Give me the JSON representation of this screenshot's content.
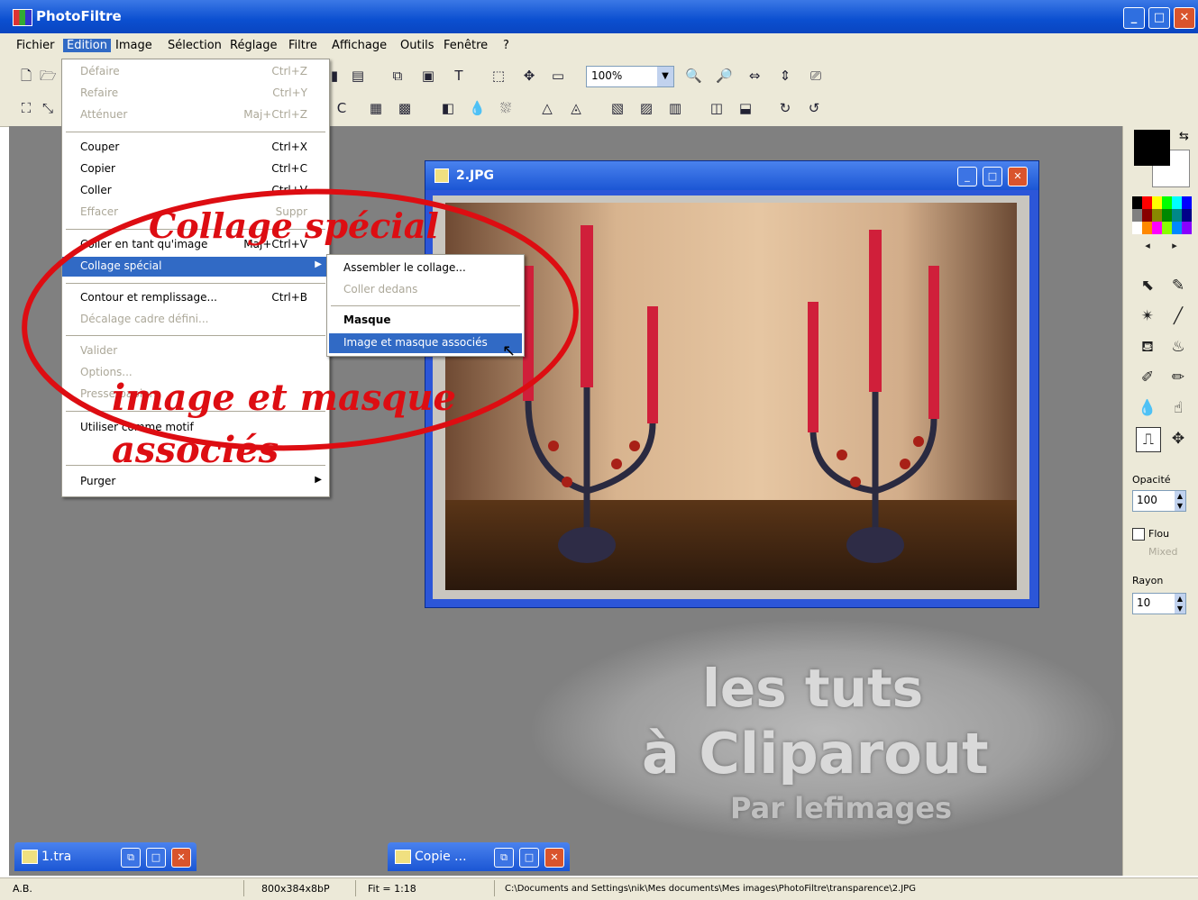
{
  "window": {
    "title": "PhotoFiltre"
  },
  "menubar": [
    "Fichier",
    "Edition",
    "Image",
    "Sélection",
    "Réglage",
    "Filtre",
    "Affichage",
    "Outils",
    "Fenêtre",
    "?"
  ],
  "toolbar": {
    "zoom": "100%"
  },
  "edit_menu": {
    "items": [
      {
        "label": "Défaire",
        "shortcut": "Ctrl+Z"
      },
      {
        "label": "Refaire",
        "shortcut": "Ctrl+Y"
      },
      {
        "label": "Atténuer",
        "shortcut": "Maj+Ctrl+Z"
      },
      {
        "label": "Couper",
        "shortcut": "Ctrl+X"
      },
      {
        "label": "Copier",
        "shortcut": "Ctrl+C"
      },
      {
        "label": "Coller",
        "shortcut": "Ctrl+V"
      },
      {
        "label": "Effacer",
        "shortcut": "Suppr"
      },
      {
        "label": "Coller en tant qu'image",
        "shortcut": "Maj+Ctrl+V"
      },
      {
        "label": "Collage spécial",
        "shortcut": ""
      },
      {
        "label": "Contour et remplissage...",
        "shortcut": "Ctrl+B"
      },
      {
        "label": "Décalage cadre défini...",
        "shortcut": ""
      },
      {
        "label": "Valider",
        "shortcut": ""
      },
      {
        "label": "Options...",
        "shortcut": ""
      },
      {
        "label": "Presse-papiers",
        "shortcut": ""
      },
      {
        "label": "Utiliser comme motif",
        "shortcut": ""
      },
      {
        "label": "Purger",
        "shortcut": ""
      }
    ]
  },
  "submenu": {
    "items": [
      "Assembler le collage...",
      "Coller dedans",
      "Masque",
      "Image et masque associés"
    ]
  },
  "annotations": {
    "collage": "Collage spécial",
    "image": "image et masque",
    "associes": "associés"
  },
  "image_window": {
    "title": "2.JPG"
  },
  "minimized": {
    "win1": "1.tra",
    "win2": "Copie ..."
  },
  "watermark": {
    "line1": "les tuts",
    "line2": "à Cliparout",
    "line3": "Par lefimages"
  },
  "right_panel": {
    "opacity_label": "Opacité",
    "opacity_value": "100",
    "flou_label": "Flou",
    "mixed_label": "Mixed",
    "rayon_label": "Rayon",
    "rayon_value": "10"
  },
  "statusbar": {
    "zone": "A.B.",
    "size": "800x384x8bP",
    "ratio": "Fit = 1:18",
    "path": "C:\\Documents and Settings\\nik\\Mes documents\\Mes images\\PhotoFiltre\\transparence\\2.JPG"
  }
}
